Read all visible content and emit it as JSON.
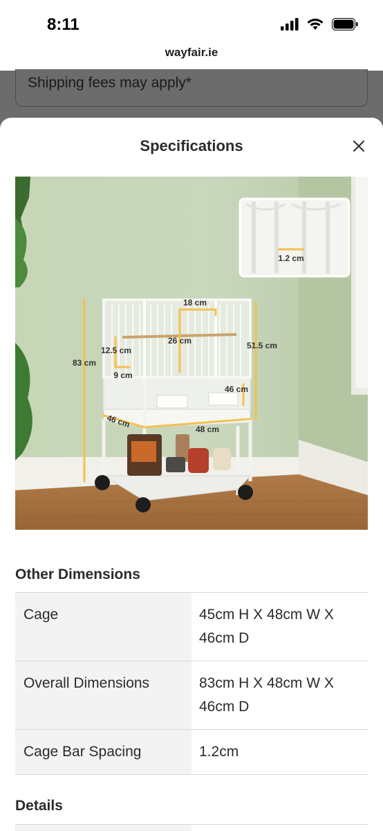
{
  "status_bar": {
    "time": "8:11",
    "url": "wayfair.ie",
    "icons": [
      "cellular-signal-icon",
      "wifi-icon",
      "battery-icon"
    ]
  },
  "background_page": {
    "shipping_note": "Shipping fees may apply*"
  },
  "sheet": {
    "title": "Specifications",
    "close_icon": "close-icon",
    "image_labels": {
      "bar_spacing": "1.2 cm",
      "top_width": "18 cm",
      "door_height": "26 cm",
      "side_door_height": "12.5 cm",
      "side_door_width": "9 cm",
      "total_height": "83 cm",
      "cage_height": "51.5 cm",
      "tray_depth": "46 cm",
      "base_depth": "46 cm",
      "base_width": "48 cm"
    },
    "other_dimensions": {
      "heading": "Other Dimensions",
      "rows": [
        {
          "label": "Cage",
          "value": "45cm H X 48cm W X 46cm D"
        },
        {
          "label": "Overall Dimensions",
          "value": "83cm H X 48cm W X 46cm D"
        },
        {
          "label": "Cage Bar Spacing",
          "value": "1.2cm"
        }
      ]
    },
    "details": {
      "heading": "Details"
    }
  },
  "colors": {
    "dim_overlay": "#6f6f6f",
    "measure_accent": "#f2c14e",
    "table_label_bg": "#f3f3f3"
  }
}
